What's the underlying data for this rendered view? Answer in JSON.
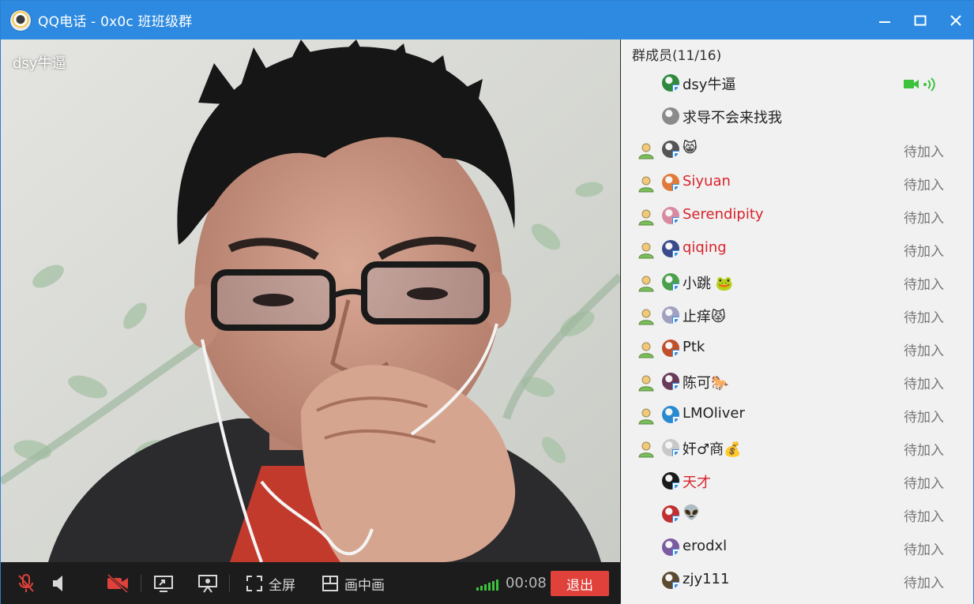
{
  "window": {
    "title": "QQ电话 - 0x0c 班班级群"
  },
  "video": {
    "speaker_name": "dsy牛逼"
  },
  "toolbar": {
    "fullscreen_label": "全屏",
    "pip_label": "画中画",
    "timer": "00:08",
    "exit_label": "退出"
  },
  "panel": {
    "header": "群成员(11/16)",
    "members": [
      {
        "name": "dsy牛逼",
        "status": "",
        "red": false,
        "avatar": "#2e8a3c"
      },
      {
        "name": "求导不会来找我",
        "status": "",
        "red": false,
        "avatar": "#8a8a8a"
      },
      {
        "name": "😸",
        "status": "待加入",
        "red": false,
        "avatar": "#555555"
      },
      {
        "name": "Siyuan",
        "status": "待加入",
        "red": true,
        "avatar": "#e07a3a"
      },
      {
        "name": "Serendipity",
        "status": "待加入",
        "red": true,
        "avatar": "#d88aa0"
      },
      {
        "name": "qiqing",
        "status": "待加入",
        "red": true,
        "avatar": "#3a4a8a"
      },
      {
        "name": "小跳 🐸",
        "status": "待加入",
        "red": false,
        "avatar": "#4ca04c"
      },
      {
        "name": "止痒😾",
        "status": "待加入",
        "red": false,
        "avatar": "#a0a0c0"
      },
      {
        "name": "Ptk",
        "status": "待加入",
        "red": false,
        "avatar": "#c0502a"
      },
      {
        "name": "陈可🐎",
        "status": "待加入",
        "red": false,
        "avatar": "#6a3a5a"
      },
      {
        "name": "LMOliver",
        "status": "待加入",
        "red": false,
        "avatar": "#2a8ad0"
      },
      {
        "name": "奸♂商💰",
        "status": "待加入",
        "red": false,
        "avatar": "#c8c8c8"
      },
      {
        "name": "天才",
        "status": "待加入",
        "red": true,
        "avatar": "#1a1a1a"
      },
      {
        "name": "👽",
        "status": "待加入",
        "red": false,
        "avatar": "#c03030"
      },
      {
        "name": "erodxl",
        "status": "待加入",
        "red": false,
        "avatar": "#7a5aa0"
      },
      {
        "name": "zjy111",
        "status": "待加入",
        "red": false,
        "avatar": "#5a4a30"
      }
    ]
  },
  "colors": {
    "titlebar": "#2d8ae0",
    "exit": "#e0413b",
    "status_red": "#d9232a",
    "online_green": "#3cc23c"
  }
}
